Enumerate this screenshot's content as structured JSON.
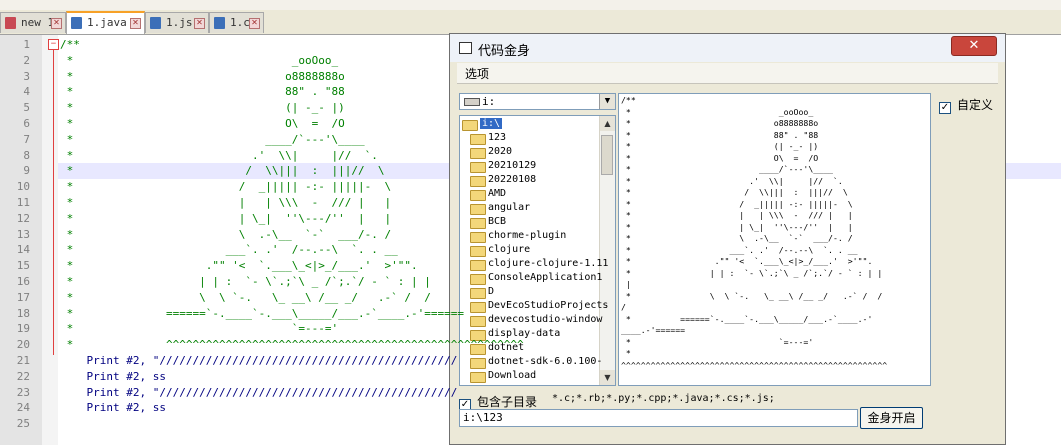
{
  "tabs": [
    {
      "label": "new 1",
      "active": false,
      "modified": true
    },
    {
      "label": "1.java",
      "active": true,
      "modified": false
    },
    {
      "label": "1.js",
      "active": false,
      "modified": false
    },
    {
      "label": "1.c",
      "active": false,
      "modified": false
    }
  ],
  "editor": {
    "line_numbers": [
      "1",
      "2",
      "3",
      "4",
      "5",
      "6",
      "7",
      "8",
      "9",
      "10",
      "11",
      "12",
      "13",
      "14",
      "15",
      "16",
      "17",
      "18",
      "19",
      "20",
      "21",
      "22",
      "23",
      "24",
      "25"
    ],
    "highlighted_line": 9,
    "lines": [
      "/**",
      " *                                 _ooOoo_",
      " *                                o8888888o",
      " *                                88\" . \"88",
      " *                                (| -_- |)",
      " *                                O\\  =  /O",
      " *                             ____/`---'\\____",
      " *                           .'  \\\\|     |//  `.",
      " *                          /  \\\\|||  :  |||//  \\",
      " *                         /  _||||| -:- |||||-  \\",
      " *                         |   | \\\\\\  -  /// |   |",
      " *                         | \\_|  ''\\---/''  |   |",
      " *                         \\  .-\\__  `-`  ___/-. /",
      " *                       ___`. .'  /--.--\\  `. . __",
      " *                    .\"\" '<  `.___\\_<|>_/___.'  >'\"\".",
      " *                   | | :  `- \\`.;`\\ _ /`;.`/ - ` : | |",
      " *                   \\  \\ `-.   \\_ __\\ /__ _/   .-` /  /",
      " *              ======`-.____`-.___\\_____/___.-`____.-'======",
      " *                                 `=---='",
      " *              ^^^^^^^^^^^^^^^^^^^^^^^^^^^^^^^^^^^^^^^^^^^^^^^^^^^^^^",
      "    Print #2, \"/////////////////////////////////////////////",
      "    Print #2, ss",
      "    Print #2, \"/////////////////////////////////////////////",
      "    Print #2, ss",
      ""
    ]
  },
  "dialog": {
    "title": "代码金身",
    "close_label": "✕",
    "menu": [
      "选项"
    ],
    "drive": "i:",
    "tree": {
      "items": [
        "i:\\",
        "123",
        "2020",
        "20210129",
        "20220108",
        "AMD",
        "angular",
        "BCB",
        "chorme-plugin",
        "clojure",
        "clojure-clojure-1.11",
        "ConsoleApplication1",
        "D",
        "DevEcoStudioProjects",
        "devecostudio-window",
        "display-data",
        "dotnet",
        "dotnet-sdk-6.0.100-",
        "Download"
      ],
      "selected": 0
    },
    "preview_lines": [
      "/**",
      " *                              _ooOoo_",
      " *                             o8888888o",
      " *                             88\" . \"88",
      " *                             (| -_- |)",
      " *                             O\\  =  /O",
      " *                          ____/`---'\\____",
      " *                        .'  \\\\|     |//  `.",
      " *                       /  \\\\|||  :  |||//  \\",
      " *                      /  _||||| -:- |||||-  \\",
      " *                      |   | \\\\\\  -  /// |   |",
      " *                      | \\_|  ''\\---/''  |   |",
      " *                      \\  .-\\__  `-`  ___/-. /",
      " *                    ___`. .'  /--.--\\  `. . __",
      " *                 .\"\" '<  `.___\\_<|>_/___.'  >'\"\".",
      " *                | | :  `- \\`.;`\\ _ /`;.`/ - ` : | |",
      " |",
      " *                \\  \\ `-.   \\_ __\\ /__ _/   .-` /  /",
      "/",
      " *          ======`-.____`-.___\\_____/___.-`____.-'",
      "____.-'======",
      " *                              `=---='",
      " *",
      "^^^^^^^^^^^^^^^^^^^^^^^^^^^^^^^^^^^^^^^^^^^^^^^^^^^^^^"
    ],
    "custom_label": "自定义",
    "custom_checked": true,
    "include_subdir_label": "包含子目录",
    "include_subdir_checked": true,
    "extensions": "*.c;*.rb;*.py;*.cpp;*.java;*.cs;*.js;",
    "path_value": "i:\\123",
    "go_button": "金身开启"
  }
}
